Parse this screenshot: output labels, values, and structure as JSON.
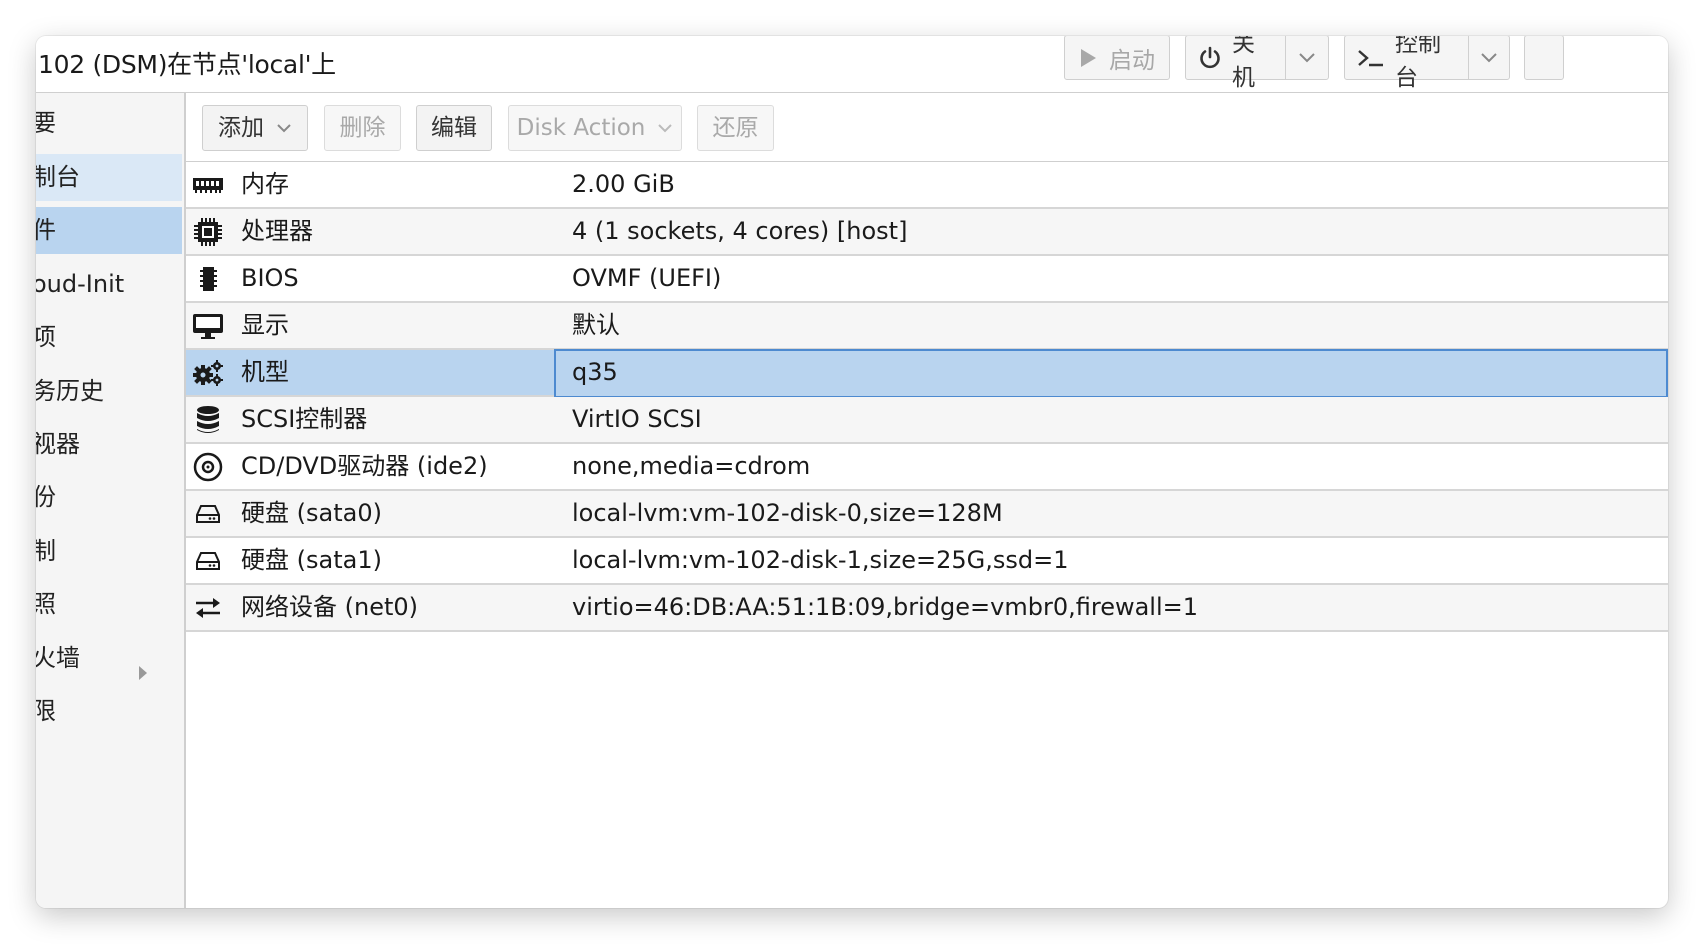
{
  "window": {
    "title": "102 (DSM)在节点'local'上"
  },
  "header_buttons": {
    "start": {
      "label": "启动",
      "icon": "play-icon",
      "disabled": true
    },
    "shutdown": {
      "label": "关机",
      "icon": "power-icon"
    },
    "console": {
      "label": "控制台",
      "icon": "terminal-icon"
    }
  },
  "sidebar": {
    "items": [
      {
        "label": "要"
      },
      {
        "label": "制台",
        "state": "hover"
      },
      {
        "label": "件",
        "state": "active"
      },
      {
        "label": "oud-Init"
      },
      {
        "label": "项"
      },
      {
        "label": "务历史"
      },
      {
        "label": "视器"
      },
      {
        "label": "份"
      },
      {
        "label": "制"
      },
      {
        "label": "照"
      },
      {
        "label": "火墙",
        "expandable": true
      },
      {
        "label": "限"
      }
    ]
  },
  "toolbar": {
    "add_label": "添加",
    "remove_label": "删除",
    "edit_label": "编辑",
    "disk_action_label": "Disk Action",
    "revert_label": "还原"
  },
  "hardware": [
    {
      "icon": "memory-icon",
      "name": "内存",
      "value": "2.00 GiB"
    },
    {
      "icon": "cpu-icon",
      "name": "处理器",
      "value": "4 (1 sockets, 4 cores) [host]"
    },
    {
      "icon": "bios-chip-icon",
      "name": "BIOS",
      "value": "OVMF (UEFI)"
    },
    {
      "icon": "monitor-icon",
      "name": "显示",
      "value": "默认"
    },
    {
      "icon": "gears-icon",
      "name": "机型",
      "value": "q35",
      "selected": true
    },
    {
      "icon": "database-icon",
      "name": "SCSI控制器",
      "value": "VirtIO SCSI"
    },
    {
      "icon": "cdrom-icon",
      "name": "CD/DVD驱动器 (ide2)",
      "value": "none,media=cdrom"
    },
    {
      "icon": "hdd-icon",
      "name": "硬盘 (sata0)",
      "value": "local-lvm:vm-102-disk-0,size=128M"
    },
    {
      "icon": "hdd-icon",
      "name": "硬盘 (sata1)",
      "value": "local-lvm:vm-102-disk-1,size=25G,ssd=1"
    },
    {
      "icon": "network-icon",
      "name": "网络设备 (net0)",
      "value": "virtio=46:DB:AA:51:1B:09,bridge=vmbr0,firewall=1"
    }
  ],
  "colors": {
    "selected_bg": "#b9d4ef",
    "selected_border": "#4d8ad0",
    "hover_bg": "#dae8f6"
  }
}
